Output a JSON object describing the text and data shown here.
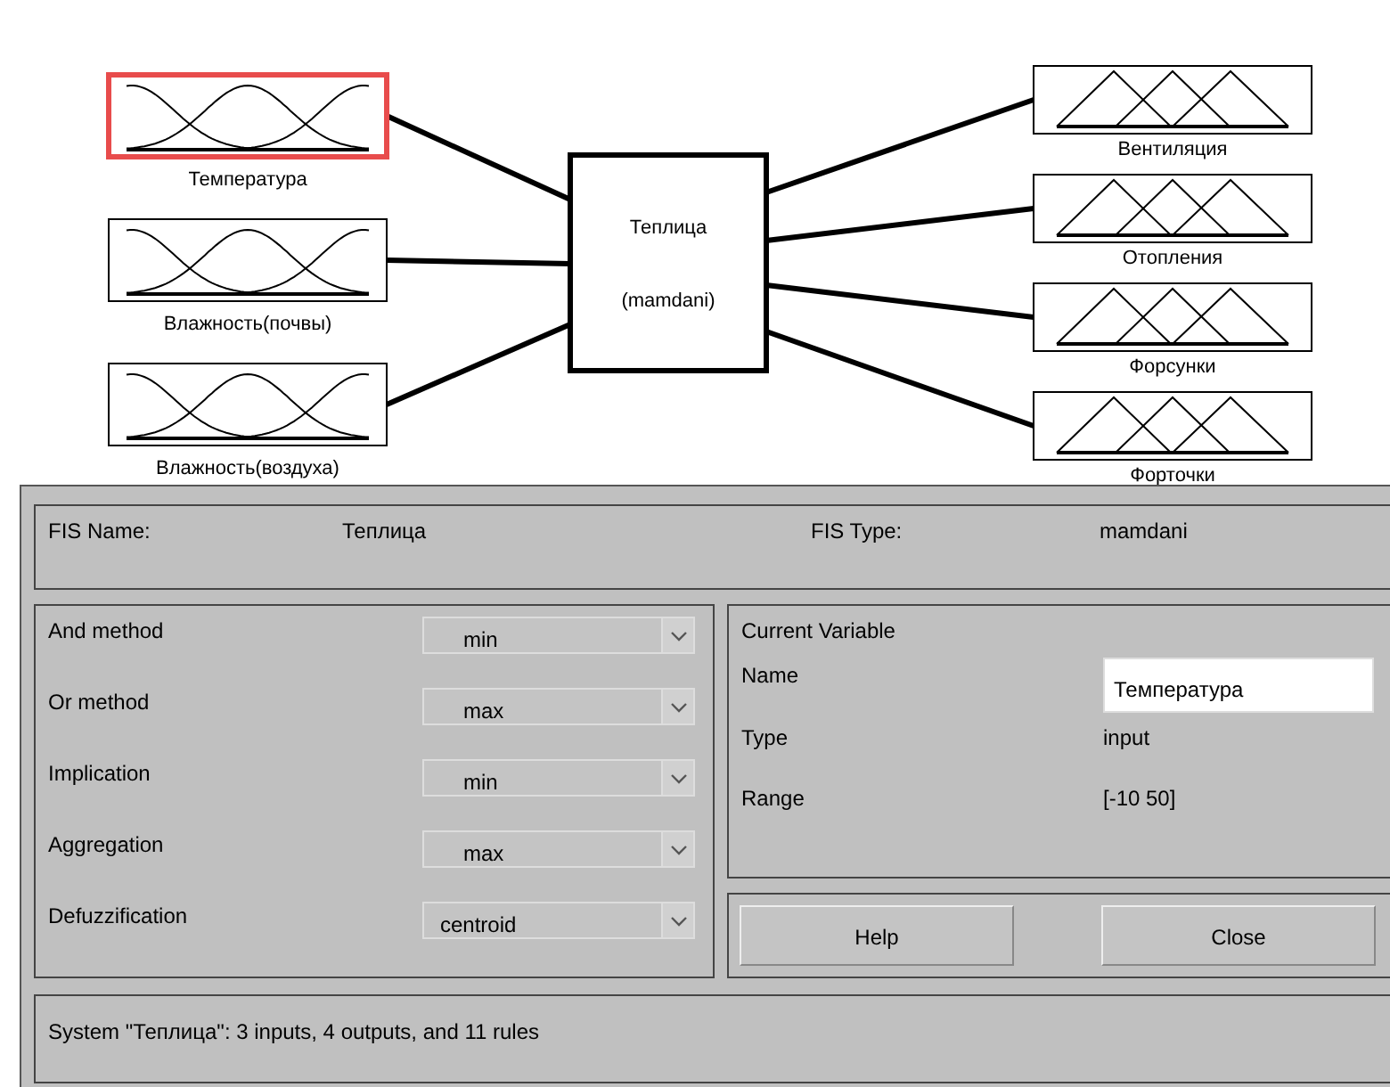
{
  "diagram": {
    "inputs": [
      {
        "name": "Температура",
        "selected": true
      },
      {
        "name": "Влажность(почвы)",
        "selected": false
      },
      {
        "name": "Влажность(воздуха)",
        "selected": false
      }
    ],
    "system": {
      "name": "Теплица",
      "type_label": "(mamdani)"
    },
    "outputs": [
      {
        "name": "Вентиляция",
        "selected": false
      },
      {
        "name": "Отопления",
        "selected": false
      },
      {
        "name": "Форсунки",
        "selected": false
      },
      {
        "name": "Форточки",
        "selected": false
      }
    ]
  },
  "fis": {
    "name_label": "FIS Name:",
    "name": "Теплица",
    "type_label": "FIS Type:",
    "type": "mamdani"
  },
  "methods": [
    {
      "label": "And method",
      "value": "min"
    },
    {
      "label": "Or method",
      "value": "max"
    },
    {
      "label": "Implication",
      "value": "min"
    },
    {
      "label": "Aggregation",
      "value": "max"
    },
    {
      "label": "Defuzzification",
      "value": "centroid"
    }
  ],
  "current_variable": {
    "title": "Current Variable",
    "name_label": "Name",
    "name": "Температура",
    "type_label": "Type",
    "type": "input",
    "range_label": "Range",
    "range": "[-10 50]"
  },
  "buttons": [
    "Help",
    "Close"
  ],
  "status_bar": "System \"Теплица\": 3 inputs, 4 outputs, and 11 rules"
}
